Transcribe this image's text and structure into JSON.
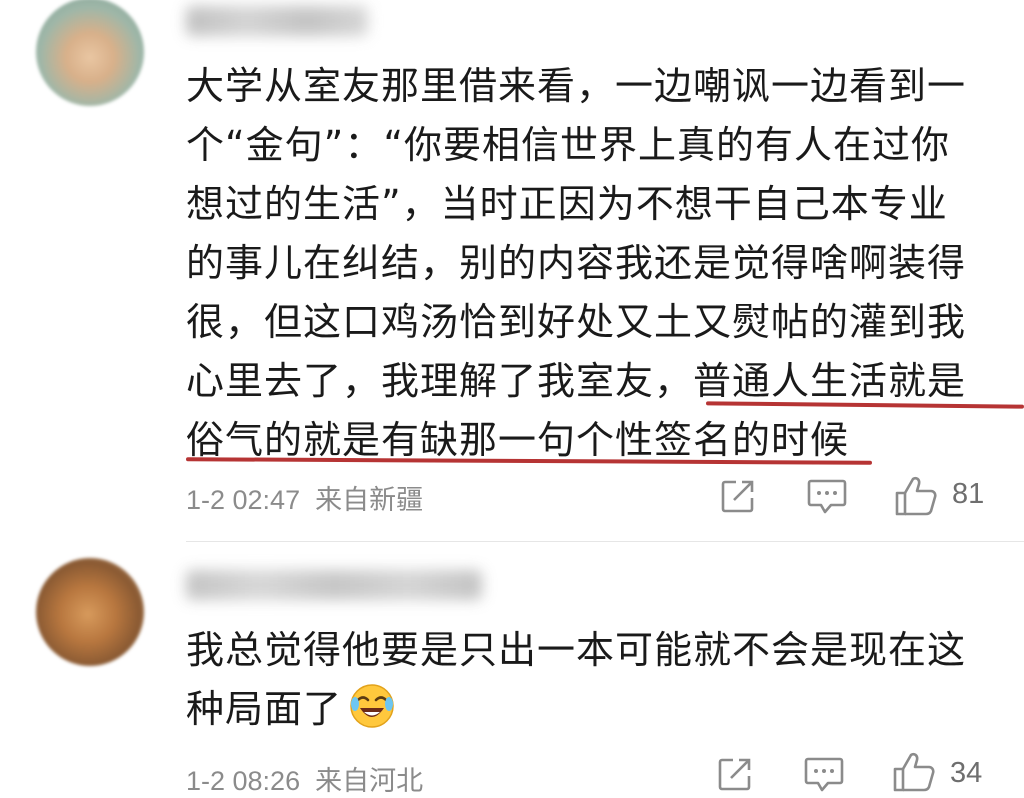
{
  "comments": [
    {
      "lines": [
        "大学从室友那里借来看，一边嘲讽一边看到一",
        "个“金句”：“你要相信世界上真的有人在过你",
        "想过的生活”，当时正因为不想干自己本专业",
        "的事儿在纠结，别的内容我还是觉得啥啊装得",
        "很，但这口鸡汤恰到好处又土又熨帖的灌到我"
      ],
      "line6_plain": "心里去了，我理解了我室友，",
      "line6_highlight": "普通人生活就是",
      "line7_highlight": "俗气的就是有缺那一句个性签名的时候",
      "time": "1-2 02:47",
      "location": "来自新疆",
      "likes": "81"
    },
    {
      "lines": [
        "我总觉得他要是只出一本可能就不会是现在这"
      ],
      "last_line": "种局面了",
      "emoji_name": "laughing-crying-emoji",
      "time": "1-2 08:26",
      "location": "来自河北",
      "likes": "34"
    }
  ],
  "colors": {
    "text": "#1a1a1a",
    "meta": "#8b8b8b",
    "underline": "#b63434"
  },
  "icons": [
    "share-icon",
    "comment-icon",
    "like-icon"
  ]
}
